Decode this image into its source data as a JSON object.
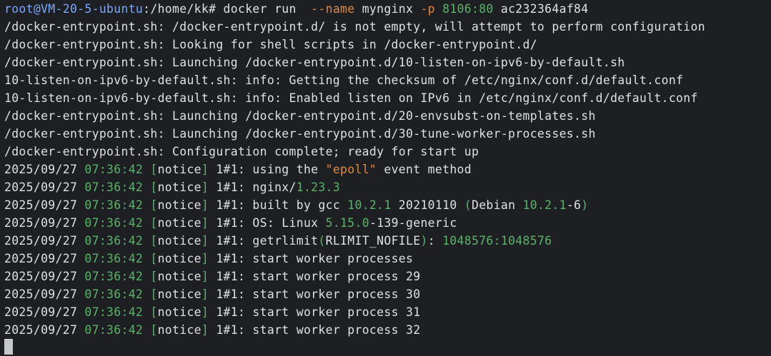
{
  "terminal": {
    "colors": {
      "background": "#1e1f22",
      "text": "#dfe1e5",
      "user": "#7aa7ff",
      "accent_orange": "#e08a45",
      "accent_green": "#5bb36b"
    },
    "lines": [
      [
        {
          "t": "root@VM-20-5-ubuntu",
          "c": "user"
        },
        {
          "t": ":/home/kk# docker run  ",
          "c": "def"
        },
        {
          "t": "--name",
          "c": "flag"
        },
        {
          "t": " mynginx ",
          "c": "def"
        },
        {
          "t": "-p",
          "c": "flag"
        },
        {
          "t": " ",
          "c": "def"
        },
        {
          "t": "8106:80",
          "c": "num"
        },
        {
          "t": " ac232364af84",
          "c": "def"
        }
      ],
      [
        {
          "t": "/docker-entrypoint.sh: /docker-entrypoint.d/ is not empty, will attempt to perform configuration",
          "c": "def"
        }
      ],
      [
        {
          "t": "/docker-entrypoint.sh: Looking for shell scripts in /docker-entrypoint.d/",
          "c": "def"
        }
      ],
      [
        {
          "t": "/docker-entrypoint.sh: Launching /docker-entrypoint.d/10-listen-on-ipv6-by-default.sh",
          "c": "def"
        }
      ],
      [
        {
          "t": "10-listen-on-ipv6-by-default.sh: info: Getting the checksum of /etc/nginx/conf.d/default.conf",
          "c": "def"
        }
      ],
      [
        {
          "t": "10-listen-on-ipv6-by-default.sh: info: Enabled listen on IPv6 in /etc/nginx/conf.d/default.conf",
          "c": "def"
        }
      ],
      [
        {
          "t": "/docker-entrypoint.sh: Launching /docker-entrypoint.d/20-envsubst-on-templates.sh",
          "c": "def"
        }
      ],
      [
        {
          "t": "/docker-entrypoint.sh: Launching /docker-entrypoint.d/30-tune-worker-processes.sh",
          "c": "def"
        }
      ],
      [
        {
          "t": "/docker-entrypoint.sh: Configuration complete; ready for start up",
          "c": "def"
        }
      ],
      [
        {
          "t": "2025/09/27 ",
          "c": "def"
        },
        {
          "t": "07:36:42",
          "c": "time"
        },
        {
          "t": " ",
          "c": "def"
        },
        {
          "t": "[",
          "c": "br"
        },
        {
          "t": "notice",
          "c": "def"
        },
        {
          "t": "]",
          "c": "br"
        },
        {
          "t": " 1#1: using the ",
          "c": "def"
        },
        {
          "t": "\"epoll\"",
          "c": "str"
        },
        {
          "t": " event method",
          "c": "def"
        }
      ],
      [
        {
          "t": "2025/09/27 ",
          "c": "def"
        },
        {
          "t": "07:36:42",
          "c": "time"
        },
        {
          "t": " ",
          "c": "def"
        },
        {
          "t": "[",
          "c": "br"
        },
        {
          "t": "notice",
          "c": "def"
        },
        {
          "t": "]",
          "c": "br"
        },
        {
          "t": " 1#1: nginx/",
          "c": "def"
        },
        {
          "t": "1.23.3",
          "c": "num"
        }
      ],
      [
        {
          "t": "2025/09/27 ",
          "c": "def"
        },
        {
          "t": "07:36:42",
          "c": "time"
        },
        {
          "t": " ",
          "c": "def"
        },
        {
          "t": "[",
          "c": "br"
        },
        {
          "t": "notice",
          "c": "def"
        },
        {
          "t": "]",
          "c": "br"
        },
        {
          "t": " 1#1: built by gcc ",
          "c": "def"
        },
        {
          "t": "10.2.1",
          "c": "num"
        },
        {
          "t": " 20210110 ",
          "c": "def"
        },
        {
          "t": "(",
          "c": "br"
        },
        {
          "t": "Debian ",
          "c": "def"
        },
        {
          "t": "10.2.1",
          "c": "num"
        },
        {
          "t": "-6",
          "c": "def"
        },
        {
          "t": ")",
          "c": "br"
        }
      ],
      [
        {
          "t": "2025/09/27 ",
          "c": "def"
        },
        {
          "t": "07:36:42",
          "c": "time"
        },
        {
          "t": " ",
          "c": "def"
        },
        {
          "t": "[",
          "c": "br"
        },
        {
          "t": "notice",
          "c": "def"
        },
        {
          "t": "]",
          "c": "br"
        },
        {
          "t": " 1#1: OS: Linux ",
          "c": "def"
        },
        {
          "t": "5.15.0",
          "c": "num"
        },
        {
          "t": "-139-generic",
          "c": "def"
        }
      ],
      [
        {
          "t": "2025/09/27 ",
          "c": "def"
        },
        {
          "t": "07:36:42",
          "c": "time"
        },
        {
          "t": " ",
          "c": "def"
        },
        {
          "t": "[",
          "c": "br"
        },
        {
          "t": "notice",
          "c": "def"
        },
        {
          "t": "]",
          "c": "br"
        },
        {
          "t": " 1#1: getrlimit",
          "c": "def"
        },
        {
          "t": "(",
          "c": "br"
        },
        {
          "t": "RLIMIT_NOFILE",
          "c": "def"
        },
        {
          "t": ")",
          "c": "br"
        },
        {
          "t": ": ",
          "c": "def"
        },
        {
          "t": "1048576:1048576",
          "c": "num"
        }
      ],
      [
        {
          "t": "2025/09/27 ",
          "c": "def"
        },
        {
          "t": "07:36:42",
          "c": "time"
        },
        {
          "t": " ",
          "c": "def"
        },
        {
          "t": "[",
          "c": "br"
        },
        {
          "t": "notice",
          "c": "def"
        },
        {
          "t": "]",
          "c": "br"
        },
        {
          "t": " 1#1: start worker processes",
          "c": "def"
        }
      ],
      [
        {
          "t": "2025/09/27 ",
          "c": "def"
        },
        {
          "t": "07:36:42",
          "c": "time"
        },
        {
          "t": " ",
          "c": "def"
        },
        {
          "t": "[",
          "c": "br"
        },
        {
          "t": "notice",
          "c": "def"
        },
        {
          "t": "]",
          "c": "br"
        },
        {
          "t": " 1#1: start worker process 29",
          "c": "def"
        }
      ],
      [
        {
          "t": "2025/09/27 ",
          "c": "def"
        },
        {
          "t": "07:36:42",
          "c": "time"
        },
        {
          "t": " ",
          "c": "def"
        },
        {
          "t": "[",
          "c": "br"
        },
        {
          "t": "notice",
          "c": "def"
        },
        {
          "t": "]",
          "c": "br"
        },
        {
          "t": " 1#1: start worker process 30",
          "c": "def"
        }
      ],
      [
        {
          "t": "2025/09/27 ",
          "c": "def"
        },
        {
          "t": "07:36:42",
          "c": "time"
        },
        {
          "t": " ",
          "c": "def"
        },
        {
          "t": "[",
          "c": "br"
        },
        {
          "t": "notice",
          "c": "def"
        },
        {
          "t": "]",
          "c": "br"
        },
        {
          "t": " 1#1: start worker process 31",
          "c": "def"
        }
      ],
      [
        {
          "t": "2025/09/27 ",
          "c": "def"
        },
        {
          "t": "07:36:42",
          "c": "time"
        },
        {
          "t": " ",
          "c": "def"
        },
        {
          "t": "[",
          "c": "br"
        },
        {
          "t": "notice",
          "c": "def"
        },
        {
          "t": "]",
          "c": "br"
        },
        {
          "t": " 1#1: start worker process 32",
          "c": "def"
        }
      ]
    ]
  }
}
